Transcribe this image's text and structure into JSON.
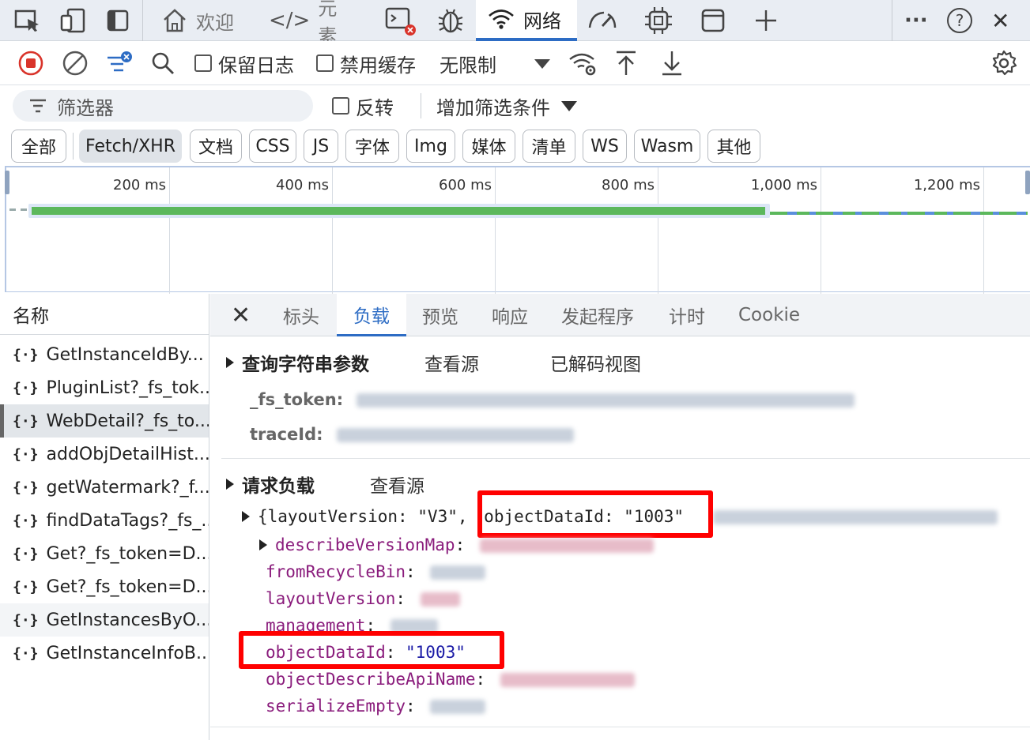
{
  "tabbar": {
    "tabs": [
      {
        "label": "",
        "icon": "inspect-icon"
      },
      {
        "label": "",
        "icon": "device-emulation-icon"
      },
      {
        "label": "",
        "icon": "sidebar-toggle-icon"
      },
      {
        "label": "欢迎",
        "icon": "home-icon"
      },
      {
        "label": "元素",
        "icon": "code-tags-icon"
      },
      {
        "label": "",
        "icon": "console-error-icon"
      },
      {
        "label": "",
        "icon": "bug-icon"
      },
      {
        "label": "网络",
        "icon": "wifi-icon"
      },
      {
        "label": "",
        "icon": "performance-gauge-icon"
      },
      {
        "label": "",
        "icon": "cpu-chip-icon"
      },
      {
        "label": "",
        "icon": "application-window-icon"
      },
      {
        "label": "",
        "icon": "plus-icon"
      }
    ],
    "more": "···",
    "help": "?",
    "close": "✕"
  },
  "toolbar": {
    "preserve_log": "保留日志",
    "disable_cache": "禁用缓存",
    "throttle": "无限制"
  },
  "filter": {
    "placeholder": "筛选器",
    "invert": "反转",
    "more_filters": "增加筛选条件"
  },
  "type_filters": [
    "全部",
    "Fetch/XHR",
    "文档",
    "CSS",
    "JS",
    "字体",
    "Img",
    "媒体",
    "清单",
    "WS",
    "Wasm",
    "其他"
  ],
  "timeline": {
    "ticks": [
      "200 ms",
      "400 ms",
      "600 ms",
      "800 ms",
      "1,000 ms",
      "1,200 ms"
    ]
  },
  "request_list": {
    "header": "名称",
    "items": [
      "GetInstanceIdBy...",
      "PluginList?_fs_tok...",
      "WebDetail?_fs_to...",
      "addObjDetailHist...",
      "getWatermark?_f...",
      "findDataTags?_fs_...",
      "Get?_fs_token=D...",
      "Get?_fs_token=D...",
      "GetInstancesByO...",
      "GetInstanceInfoB..."
    ],
    "selected_index": 2
  },
  "detail": {
    "tabs": [
      "标头",
      "负载",
      "预览",
      "响应",
      "发起程序",
      "计时",
      "Cookie"
    ],
    "active_tab": "负载",
    "query_section": {
      "title": "查询字符串参数",
      "view_source": "查看源",
      "view_decoded": "已解码视图",
      "params": [
        {
          "key": "_fs_token:"
        },
        {
          "key": "traceId:"
        }
      ]
    },
    "payload_section": {
      "title": "请求负载",
      "view_source": "查看源",
      "summary_prefix": "{layoutVersion: \"V3\",",
      "summary_highlight": "objectDataId: \"1003\"",
      "fields": [
        {
          "key": "describeVersionMap",
          "value": "",
          "expandable": true
        },
        {
          "key": "fromRecycleBin",
          "value": ""
        },
        {
          "key": "layoutVersion",
          "value": ""
        },
        {
          "key": "management",
          "value": ""
        },
        {
          "key": "objectDataId",
          "value": "\"1003\""
        },
        {
          "key": "objectDescribeApiName",
          "value": ""
        },
        {
          "key": "serializeEmpty",
          "value": ""
        }
      ]
    }
  },
  "colors": {
    "accent": "#2d6cc4",
    "highlight_box": "#ff0000",
    "waterfall_green": "#5cb85c",
    "waterfall_blue": "#5b8fdc"
  }
}
